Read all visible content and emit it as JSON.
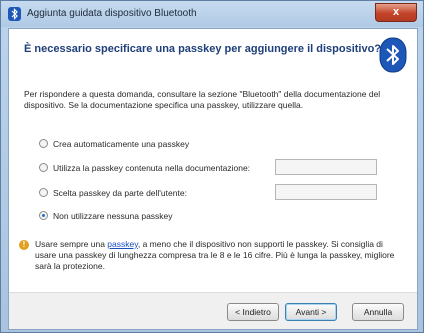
{
  "window": {
    "title": "Aggiunta guidata dispositivo Bluetooth",
    "close_label": "x"
  },
  "main": {
    "heading": "È necessario specificare una passkey per aggiungere il dispositivo?",
    "intro": "Per rispondere a questa domanda, consultare la sezione \"Bluetooth\" della documentazione del dispositivo. Se la documentazione specifica una passkey, utilizzare quella.",
    "options": [
      {
        "label": "Crea automaticamente una passkey",
        "selected": false
      },
      {
        "label": "Utilizza la passkey contenuta nella documentazione:",
        "selected": false
      },
      {
        "label": "Scelta passkey da parte dell'utente:",
        "selected": false
      },
      {
        "label": "Non utilizzare nessuna passkey",
        "selected": true
      }
    ],
    "notice_before": "Usare sempre una ",
    "notice_link": "passkey",
    "notice_after": ", a meno che il dispositivo non supporti le passkey. Si consiglia di usare una passkey di lunghezza compresa tra le 8 e le 16 cifre. Più è lunga la passkey, migliore sarà la protezione."
  },
  "footer": {
    "back_label": "< Indietro",
    "next_label": "Avanti >",
    "cancel_label": "Annulla"
  },
  "colors": {
    "heading": "#1f3f7a",
    "link": "#1a4fc0",
    "bluetooth_badge": "#1d57b8"
  }
}
